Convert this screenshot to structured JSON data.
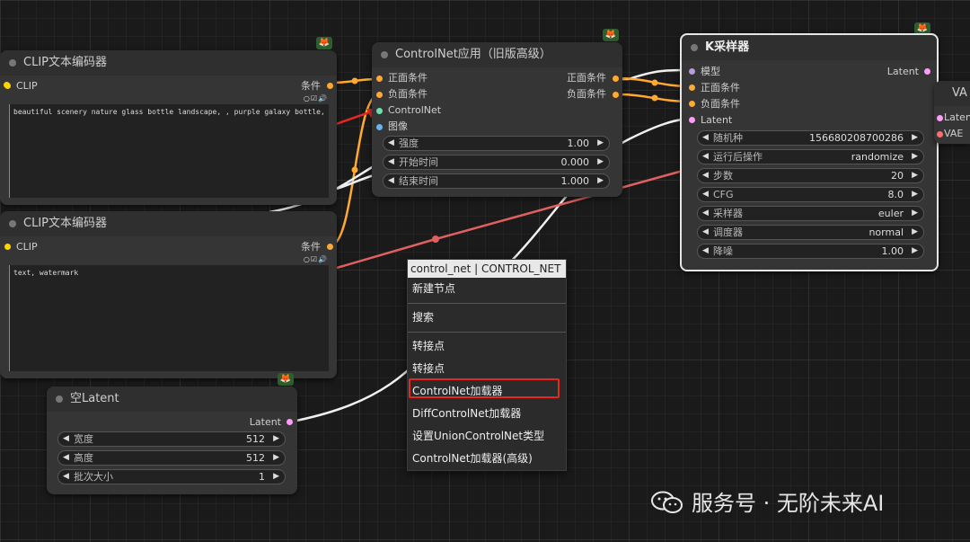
{
  "nodes": {
    "clip1": {
      "title": "CLIP文本编码器",
      "input_label": "CLIP",
      "output_label": "条件",
      "text": "beautiful scenery nature glass bottle landscape, , purple galaxy bottle,"
    },
    "clip2": {
      "title": "CLIP文本编码器",
      "input_label": "CLIP",
      "output_label": "条件",
      "text": "text, watermark"
    },
    "empty_latent": {
      "title": "空Latent",
      "output_label": "Latent",
      "widgets": [
        {
          "label": "宽度",
          "value": "512"
        },
        {
          "label": "高度",
          "value": "512"
        },
        {
          "label": "批次大小",
          "value": "1"
        }
      ]
    },
    "controlnet_apply": {
      "title": "ControlNet应用（旧版高级）",
      "inputs": [
        "正面条件",
        "负面条件",
        "ControlNet",
        "图像"
      ],
      "outputs": [
        "正面条件",
        "负面条件"
      ],
      "widgets": [
        {
          "label": "强度",
          "value": "1.00"
        },
        {
          "label": "开始时间",
          "value": "0.000"
        },
        {
          "label": "结束时间",
          "value": "1.000"
        }
      ]
    },
    "ksampler": {
      "title": "K采样器",
      "inputs": [
        "模型",
        "正面条件",
        "负面条件",
        "Latent"
      ],
      "output_label": "Latent",
      "widgets": [
        {
          "label": "随机种",
          "value": "156680208700286"
        },
        {
          "label": "运行后操作",
          "value": "randomize"
        },
        {
          "label": "步数",
          "value": "20"
        },
        {
          "label": "CFG",
          "value": "8.0"
        },
        {
          "label": "采样器",
          "value": "euler"
        },
        {
          "label": "调度器",
          "value": "normal"
        },
        {
          "label": "降噪",
          "value": "1.00"
        }
      ]
    },
    "vae_partial": {
      "title": "VA",
      "inputs": [
        "Laten",
        "VAE"
      ]
    }
  },
  "context_menu": {
    "header": "control_net | CONTROL_NET",
    "items": [
      "新建节点",
      "搜索",
      "转接点",
      "转接点",
      "ControlNet加载器",
      "DiffControlNet加载器",
      "设置UnionControlNet类型",
      "ControlNet加载器(高级)"
    ],
    "highlighted_item": "ControlNet加载器"
  },
  "watermark": "服务号 · 无阶未来AI",
  "colors": {
    "conditioning": "#ffa931",
    "controlnet": "#6ee0b0",
    "image": "#64b5f6",
    "latent": "#ff9cf9",
    "model": "#b39ddb",
    "clip": "#ffd500",
    "vae": "#ff6e6e",
    "wire_white": "#f5f5f5",
    "wire_red": "#e06060",
    "highlight_red": "#e8281e"
  },
  "icons": {
    "node_badge": "fox-icon",
    "arrow_annotation": "red-arrow-icon"
  }
}
